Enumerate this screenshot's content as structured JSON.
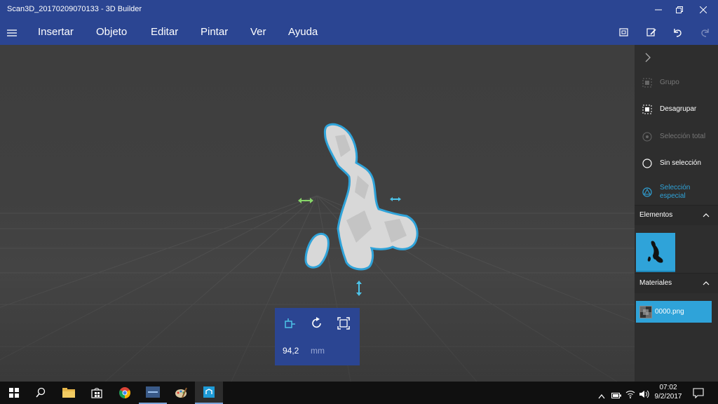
{
  "window": {
    "title": "Scan3D_20170209070133 - 3D Builder"
  },
  "menu": {
    "items": [
      "Insertar",
      "Objeto",
      "Editar",
      "Pintar",
      "Ver",
      "Ayuda"
    ]
  },
  "panel": {
    "items": [
      {
        "label": "Grupo",
        "enabled": false
      },
      {
        "label": "Desagrupar",
        "enabled": true
      },
      {
        "label": "Selección total",
        "enabled": false
      },
      {
        "label": "Sin selección",
        "enabled": true
      },
      {
        "label": "Selección especial",
        "enabled": true,
        "accent": true
      }
    ],
    "elementos_label": "Elementos",
    "materiales_label": "Materiales",
    "material_name": "0000.png"
  },
  "transform": {
    "value": "94,2",
    "unit": "mm"
  },
  "taskbar": {
    "time": "07:02",
    "date": "9/2/2017"
  },
  "colors": {
    "accent": "#2b4592",
    "selection": "#2fa3d9",
    "handle_green": "#86d468",
    "handle_blue": "#4dc3e8"
  }
}
